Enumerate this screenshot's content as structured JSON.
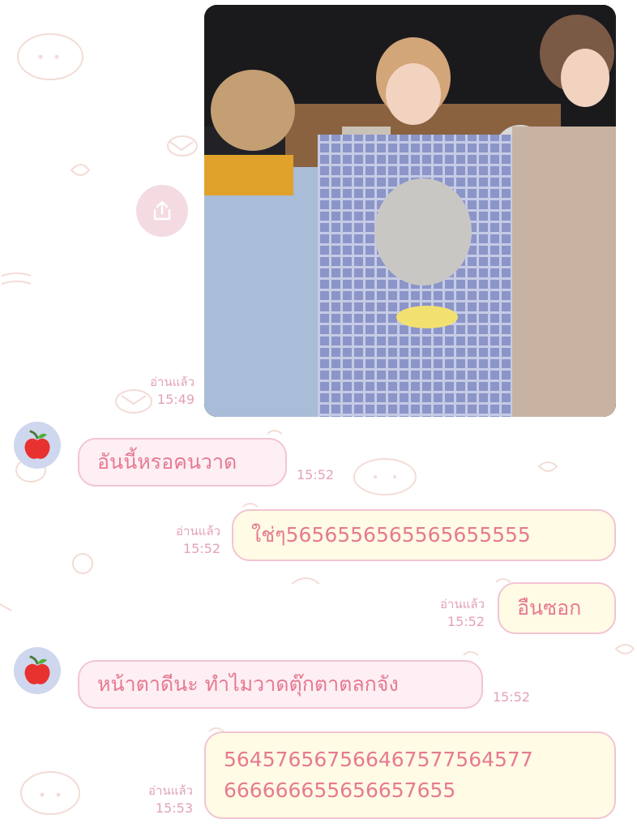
{
  "colors": {
    "text_pink": "#e67a92",
    "meta_pink": "#e2a3b6",
    "bubble_in_bg": "#fdeff3",
    "bubble_out_bg": "#fffbe4",
    "bubble_border": "#f1c5d2",
    "avatar_bg": "#cfd7ee"
  },
  "icons": {
    "share": "share-icon",
    "avatar": "apple-icon"
  },
  "messages": [
    {
      "direction": "outgoing",
      "kind": "image",
      "read": "อ่านแล้ว",
      "time": "15:49"
    },
    {
      "direction": "incoming",
      "kind": "text",
      "text": "อันนี้หรอคนวาด",
      "time": "15:52"
    },
    {
      "direction": "outgoing",
      "kind": "text",
      "text": "ใช่ๆ565655656556565555​5",
      "read": "อ่านแล้ว",
      "time": "15:52"
    },
    {
      "direction": "outgoing",
      "kind": "text",
      "text": "อืนซอก",
      "read": "อ่านแล้ว",
      "time": "15:52"
    },
    {
      "direction": "incoming",
      "kind": "text",
      "text": "หน้าตาดีนะ ทำไมวาดตุ๊กตาตลกจัง",
      "time": "15:52"
    },
    {
      "direction": "outgoing",
      "kind": "text",
      "lines": [
        "5645765675664675775645​77",
        "66666665565665765​5"
      ],
      "read": "อ่านแล้ว",
      "time": "15:53"
    }
  ]
}
